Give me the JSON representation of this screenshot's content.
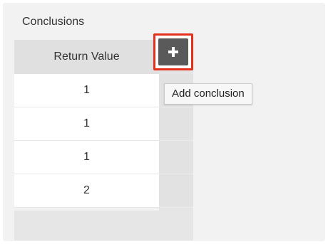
{
  "section": {
    "title": "Conclusions"
  },
  "table": {
    "column_header": "Return Value",
    "rows": [
      "1",
      "1",
      "1",
      "2"
    ]
  },
  "add_button": {
    "icon": "plus-icon",
    "tooltip": "Add conclusion"
  },
  "colors": {
    "highlight": "#e4301a",
    "button": "#5a5a5a"
  }
}
